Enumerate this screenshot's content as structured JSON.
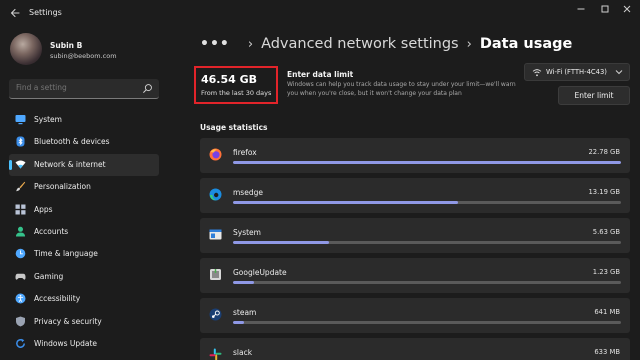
{
  "window": {
    "title": "Settings",
    "back_icon": "arrow-left-icon",
    "controls": [
      "minimize-icon",
      "maximize-icon",
      "close-icon"
    ]
  },
  "profile": {
    "name": "Subin B",
    "email": "subin@beebom.com"
  },
  "search": {
    "placeholder": "Find a setting",
    "icon": "search-icon"
  },
  "sidebar": {
    "accent": "#4cc2ff",
    "items": [
      {
        "label": "System",
        "icon": "monitor-icon",
        "color": "#4fa8ff",
        "active": false
      },
      {
        "label": "Bluetooth & devices",
        "icon": "bluetooth-icon",
        "color": "#3b8eea",
        "active": false
      },
      {
        "label": "Network & internet",
        "icon": "wifi-icon",
        "color": "#ffffff",
        "active": true
      },
      {
        "label": "Personalization",
        "icon": "brush-icon",
        "color": "#e8a84d",
        "active": false
      },
      {
        "label": "Apps",
        "icon": "apps-icon",
        "color": "#b9c3d6",
        "active": false
      },
      {
        "label": "Accounts",
        "icon": "person-icon",
        "color": "#35c28b",
        "active": false
      },
      {
        "label": "Time & language",
        "icon": "globe-clock-icon",
        "color": "#4fa8ff",
        "active": false
      },
      {
        "label": "Gaming",
        "icon": "gamepad-icon",
        "color": "#c8c8c8",
        "active": false
      },
      {
        "label": "Accessibility",
        "icon": "accessibility-icon",
        "color": "#4fa8ff",
        "active": false
      },
      {
        "label": "Privacy & security",
        "icon": "shield-icon",
        "color": "#9aa3b2",
        "active": false
      },
      {
        "label": "Windows Update",
        "icon": "update-icon",
        "color": "#3b8eea",
        "active": false
      }
    ]
  },
  "header": {
    "breadcrumb_dots": "•••",
    "breadcrumb_parent": "Advanced network settings",
    "separator": "›",
    "title": "Data usage"
  },
  "usage": {
    "total": "46.54 GB",
    "period": "From the last 30 days",
    "highlight_color": "#e2242a"
  },
  "limit": {
    "title": "Enter data limit",
    "description": "Windows can help you track data usage to stay under your limit—we'll warn you when you're close, but it won't change your data plan",
    "network_select": "Wi-Fi (FTTH-4C43)",
    "button": "Enter limit"
  },
  "stats": {
    "title": "Usage statistics",
    "bar_color": "#8f98e6",
    "apps": [
      {
        "name": "firefox",
        "size": "22.78 GB",
        "fraction": 1.0,
        "icon": "firefox-icon"
      },
      {
        "name": "msedge",
        "size": "13.19 GB",
        "fraction": 0.579,
        "icon": "edge-icon"
      },
      {
        "name": "System",
        "size": "5.63 GB",
        "fraction": 0.247,
        "icon": "system-icon"
      },
      {
        "name": "GoogleUpdate",
        "size": "1.23 GB",
        "fraction": 0.054,
        "icon": "google-update-icon"
      },
      {
        "name": "steam",
        "size": "641 MB",
        "fraction": 0.028,
        "icon": "steam-icon"
      },
      {
        "name": "slack",
        "size": "633 MB",
        "fraction": 0.027,
        "icon": "slack-icon"
      }
    ]
  }
}
